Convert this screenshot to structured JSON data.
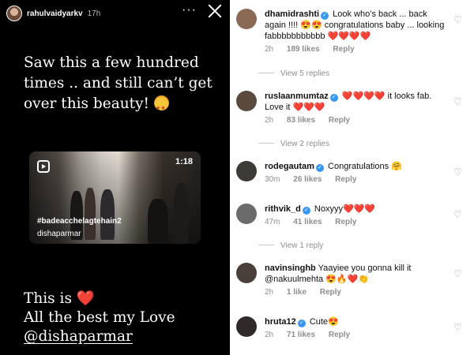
{
  "story": {
    "username": "rahulvaidyarkv",
    "time": "17h",
    "more_icon": "more-horizontal-icon",
    "close_icon": "close-icon",
    "caption": "Saw this a few hundred times .. and still can’t get over this beauty!",
    "caption_emoji": "star-struck-emoji",
    "reel": {
      "duration": "1:18",
      "hashtag": "#badeacchelagtehain2",
      "author": "dishaparmar"
    },
    "bottom_line1": "This is",
    "bottom_heart": "❤️",
    "bottom_line2": "All the best my Love",
    "bottom_mention": "@dishaparmar"
  },
  "comments": [
    {
      "user": "dhamidrashti",
      "verified": true,
      "text": "Look who’s back ... back again !!!! 😍😍 congratulations baby ... looking fabbbbbbbbbbb",
      "hearts": "❤️❤️❤️❤️",
      "time": "2h",
      "likes": "189 likes",
      "reply": "Reply",
      "view_replies": "View 5 replies",
      "avatar_color": "#8a6a55"
    },
    {
      "user": "ruslaanmumtaz",
      "verified": true,
      "text_pre": "",
      "hearts_pre": "❤️❤️❤️❤️",
      "text": "it looks fab. Love it",
      "hearts": "❤️❤️❤️",
      "time": "2h",
      "likes": "83 likes",
      "reply": "Reply",
      "view_replies": "View 2 replies",
      "avatar_color": "#5a4a3e"
    },
    {
      "user": "rodegautam",
      "verified": true,
      "text": "Congratulations 🤗",
      "time": "30m",
      "likes": "26 likes",
      "reply": "Reply",
      "avatar_color": "#3e3a36"
    },
    {
      "user": "rithvik_d",
      "verified": true,
      "text": "Noxyyy",
      "hearts": "❤️❤️❤️",
      "time": "47m",
      "likes": "41 likes",
      "reply": "Reply",
      "view_replies": "View 1 reply",
      "avatar_color": "#6b6b6b"
    },
    {
      "user": "navinsinghb",
      "verified": false,
      "text": "Yaayiee you gonna kill it",
      "mention": "@nakuulmehta",
      "emoji_tail": "😍🔥❤️👏",
      "time": "2h",
      "likes": "1 like",
      "reply": "Reply",
      "avatar_color": "#4a3f38"
    },
    {
      "user": "hruta12",
      "verified": true,
      "text": "Cute😍",
      "time": "2h",
      "likes": "71 likes",
      "reply": "Reply",
      "avatar_color": "#2f2a27"
    }
  ],
  "icons": {
    "like": "heart-outline-icon",
    "verified": "verified-badge-icon"
  }
}
